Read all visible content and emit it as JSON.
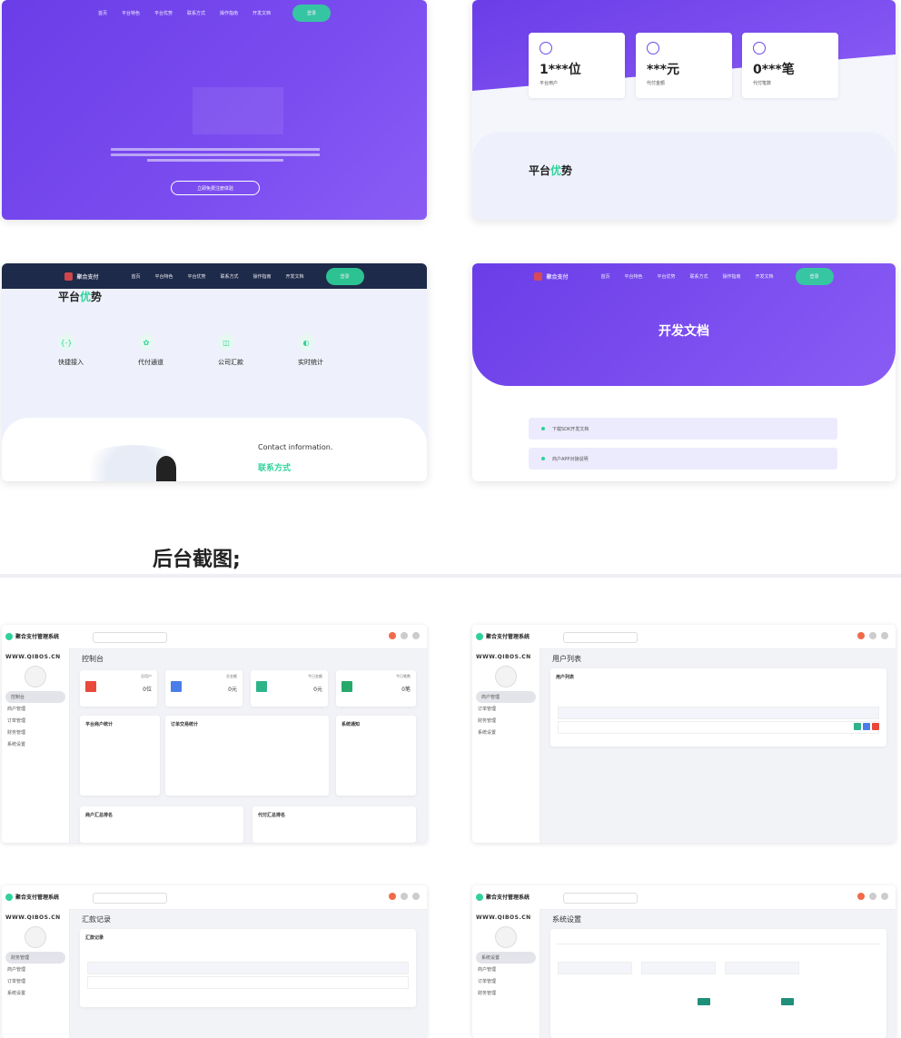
{
  "landing": {
    "nav_items": [
      "首页",
      "平台特色",
      "平台优势",
      "联系方式",
      "操作指南",
      "开发文档"
    ],
    "login": "登录",
    "brand": "聚合支付",
    "hero_button": "立即免费注册体验"
  },
  "stats": [
    {
      "value": "1***位",
      "label": "平台用户"
    },
    {
      "value": "***元",
      "label": "代付金额"
    },
    {
      "value": "0***笔",
      "label": "代付笔数"
    }
  ],
  "advantage": {
    "title_prefix": "平台",
    "title_accent": "优",
    "title_suffix": "势",
    "features": [
      {
        "icon": "{-}",
        "title": "快捷接入"
      },
      {
        "icon": "✿",
        "title": "代付通道"
      },
      {
        "icon": "◫",
        "title": "公司汇款"
      },
      {
        "icon": "◐",
        "title": "实时统计"
      }
    ]
  },
  "contact": {
    "en": "Contact information.",
    "cn": "联系方式"
  },
  "docs": {
    "title": "开发文档",
    "rows": [
      "下载SDK开发文档",
      "商户APP对接说明"
    ]
  },
  "section_heading": "后台截图;",
  "admin": {
    "system_name": "聚合支付管理系统",
    "site": "WWW.QIBOS.CN",
    "menu": [
      "控制台",
      "商户管理",
      "订单管理",
      "财务管理",
      "系统设置"
    ],
    "pages": [
      "控制台",
      "用户列表",
      "汇款记录",
      "系统设置"
    ],
    "dash_cards": [
      {
        "label": "总用户",
        "value": "0位",
        "color": "#e8493b"
      },
      {
        "label": "总金额",
        "value": "0元",
        "color": "#4a7de8"
      },
      {
        "label": "今日金额",
        "value": "0元",
        "color": "#2fb38a"
      },
      {
        "label": "今日笔数",
        "value": "0笔",
        "color": "#27a96b"
      }
    ],
    "panels": [
      "平台商户统计",
      "订单交易统计",
      "系统通知",
      "商户汇总排名",
      "代付汇总排名"
    ],
    "list_title": "用户列表",
    "remit_title": "汇款记录"
  }
}
